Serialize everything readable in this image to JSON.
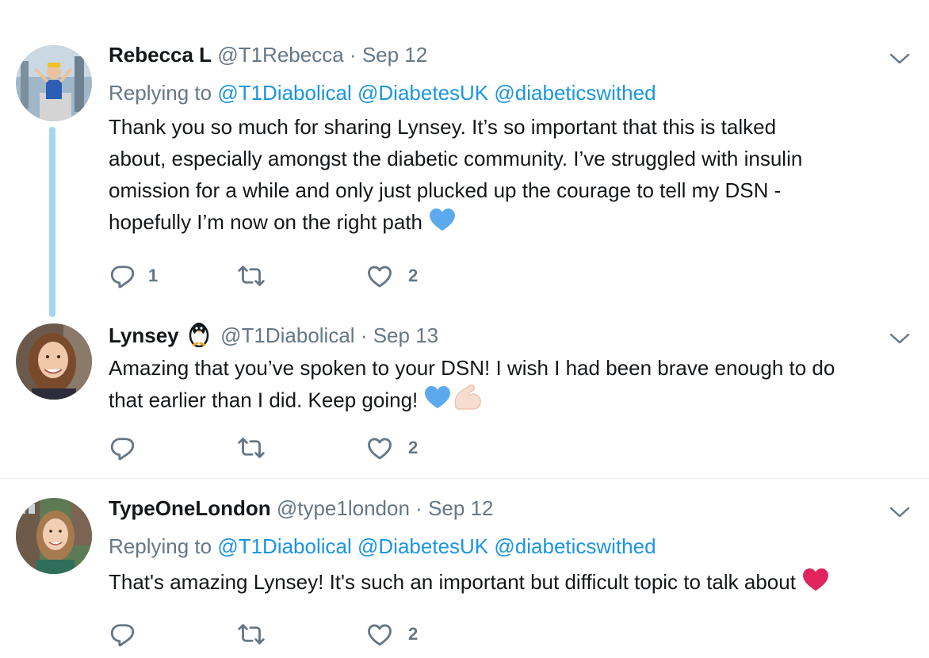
{
  "colors": {
    "accent": "#1b95e0",
    "secondary_text": "#657786",
    "thread_line": "#a5d5f5",
    "blue_heart": "#5da9ee",
    "red_heart": "#e0245e"
  },
  "tweets": [
    {
      "name": "Rebecca L",
      "handle": "@T1Rebecca",
      "separator": "·",
      "date": "Sep 12",
      "replying_prefix": "Replying to",
      "mentions": [
        "@T1Diabolical",
        "@DiabetesUK",
        "@diabeticswithed"
      ],
      "text_lines": [
        "Thank you so much for sharing Lynsey. It’s so important that this is talked",
        "about, especially amongst the diabetic community. I’ve struggled with insulin",
        "omission for a while and only just plucked up the courage to tell my DSN -",
        "hopefully I’m now on the right path"
      ],
      "emojis": [
        "blue-heart"
      ],
      "reply_count": "1",
      "retweet_count": "",
      "like_count": "2"
    },
    {
      "name": "Lynsey",
      "name_emoji": "penguin",
      "handle": "@T1Diabolical",
      "separator": "·",
      "date": "Sep 13",
      "text_lines": [
        "Amazing that you’ve spoken to your DSN! I wish I had been brave enough to do",
        "that earlier than I did. Keep going!"
      ],
      "emojis": [
        "blue-heart",
        "flexed-biceps"
      ],
      "reply_count": "",
      "retweet_count": "",
      "like_count": "2"
    },
    {
      "name": "TypeOneLondon",
      "handle": "@type1london",
      "separator": "·",
      "date": "Sep 12",
      "replying_prefix": "Replying to",
      "mentions": [
        "@T1Diabolical",
        "@DiabetesUK",
        "@diabeticswithed"
      ],
      "text_lines": [
        "That's amazing Lynsey! It's such an important but difficult topic to talk about"
      ],
      "emojis": [
        "red-heart"
      ],
      "reply_count": "",
      "retweet_count": "",
      "like_count": "2"
    }
  ]
}
